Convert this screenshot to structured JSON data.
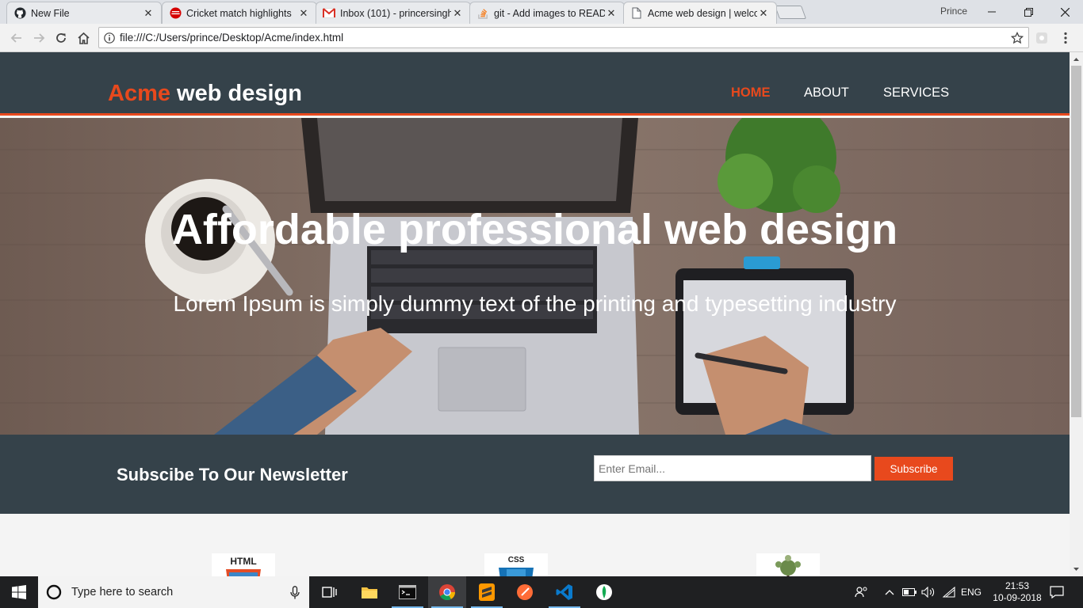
{
  "browser": {
    "tabs": [
      {
        "title": "New File",
        "icon": "github-icon"
      },
      {
        "title": "Cricket match highlights",
        "icon": "espn-cricinfo-icon"
      },
      {
        "title": "Inbox (101) - princersingh",
        "icon": "gmail-icon"
      },
      {
        "title": "git - Add images to READ",
        "icon": "stackoverflow-icon"
      },
      {
        "title": "Acme web design | welco",
        "icon": "document-icon"
      }
    ],
    "profile_name": "Prince",
    "url": "file:///C:/Users/prince/Desktop/Acme/index.html"
  },
  "site": {
    "brand_highlight": "Acme",
    "brand_rest": " web design",
    "nav": [
      "HOME",
      "ABOUT",
      "SERVICES"
    ],
    "hero_title": "Affordable professional web design",
    "hero_subtitle": "Lorem Ipsum is simply dummy text of the printing and typesetting industry",
    "newsletter_title": "Subscibe To Our Newsletter",
    "email_placeholder": "Enter Email...",
    "subscribe_label": "Subscribe",
    "box_logos": [
      "HTML",
      "CSS",
      ""
    ]
  },
  "colors": {
    "accent": "#e8491d",
    "dark": "#35424a"
  },
  "taskbar": {
    "search_placeholder": "Type here to search",
    "language": "ENG",
    "time": "21:53",
    "date": "10-09-2018"
  }
}
